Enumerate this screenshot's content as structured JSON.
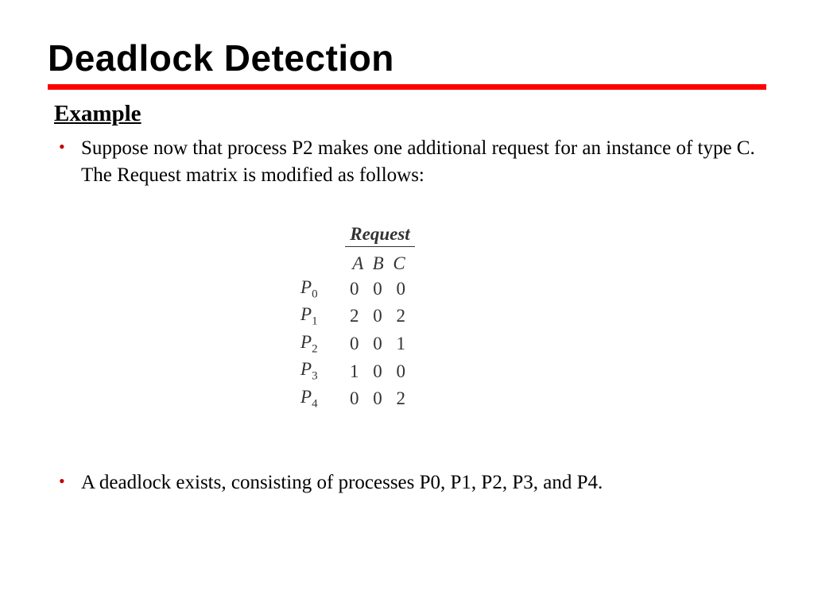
{
  "title": "Deadlock Detection",
  "subheading": "Example",
  "bullets": {
    "b1": "Suppose now that process P2 makes one additional request for an instance of type C. The Request matrix is modified as follows:",
    "b2": "A deadlock exists, consisting of processes P0, P1, P2, P3, and P4."
  },
  "matrix": {
    "title": "Request",
    "cols": "A B C",
    "rows": [
      {
        "proc": "P",
        "sub": "0",
        "vals": "0 0 0"
      },
      {
        "proc": "P",
        "sub": "1",
        "vals": "2 0 2"
      },
      {
        "proc": "P",
        "sub": "2",
        "vals": "0 0 1"
      },
      {
        "proc": "P",
        "sub": "3",
        "vals": "1 0 0"
      },
      {
        "proc": "P",
        "sub": "4",
        "vals": "0 0 2"
      }
    ]
  },
  "chart_data": {
    "type": "table",
    "title": "Request",
    "columns": [
      "A",
      "B",
      "C"
    ],
    "rows": [
      {
        "process": "P0",
        "A": 0,
        "B": 0,
        "C": 0
      },
      {
        "process": "P1",
        "A": 2,
        "B": 0,
        "C": 2
      },
      {
        "process": "P2",
        "A": 0,
        "B": 0,
        "C": 1
      },
      {
        "process": "P3",
        "A": 1,
        "B": 0,
        "C": 0
      },
      {
        "process": "P4",
        "A": 0,
        "B": 0,
        "C": 2
      }
    ]
  }
}
